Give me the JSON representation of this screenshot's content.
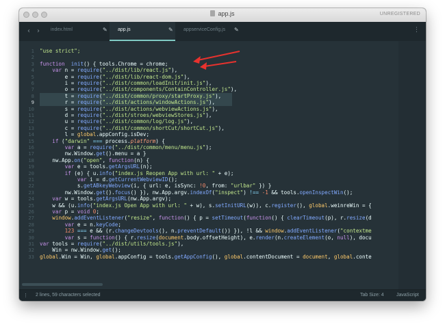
{
  "window": {
    "title": "app.js",
    "registration": "UNREGISTERED"
  },
  "nav": {
    "back": "‹",
    "forward": "›"
  },
  "tabs": [
    {
      "label": "index.html",
      "active": false
    },
    {
      "label": "app.js",
      "active": true
    },
    {
      "label": "appserviceConfig.js",
      "active": false
    }
  ],
  "editor": {
    "current_line": 9,
    "lines": [
      {
        "n": 1,
        "t": [
          [
            "str",
            "\"use strict\";"
          ]
        ]
      },
      {
        "n": 2,
        "t": []
      },
      {
        "n": 3,
        "t": [
          [
            "kw",
            "function"
          ],
          [
            "",
            "  "
          ],
          [
            "fn",
            "init"
          ],
          [
            "",
            "() { tools.Chrome = chrome;"
          ]
        ]
      },
      {
        "n": 4,
        "t": [
          [
            "",
            "    "
          ],
          [
            "kw",
            "var"
          ],
          [
            "",
            " n = "
          ],
          [
            "fn",
            "require"
          ],
          [
            "",
            "("
          ],
          [
            "str",
            "\"../dist/lib/react.js\""
          ],
          [
            "",
            "),"
          ]
        ]
      },
      {
        "n": 5,
        "t": [
          [
            "",
            "        e = "
          ],
          [
            "fn",
            "require"
          ],
          [
            "",
            "("
          ],
          [
            "str",
            "\"../dist/lib/react-dom.js\""
          ],
          [
            "",
            "),"
          ]
        ]
      },
      {
        "n": 6,
        "t": [
          [
            "",
            "        i = "
          ],
          [
            "fn",
            "require"
          ],
          [
            "",
            "("
          ],
          [
            "str",
            "\"../dist/common/loadInit/init.js\""
          ],
          [
            "",
            "),"
          ]
        ]
      },
      {
        "n": 7,
        "t": [
          [
            "",
            "        o = "
          ],
          [
            "fn",
            "require"
          ],
          [
            "",
            "("
          ],
          [
            "str",
            "\"../dist/components/ContainController.js\""
          ],
          [
            "",
            "),"
          ]
        ]
      },
      {
        "n": 8,
        "t": [
          [
            "",
            "        t = "
          ],
          [
            "fn",
            "require"
          ],
          [
            "",
            "("
          ],
          [
            "str",
            "\"../dist/common/proxy/startProxy.js\""
          ],
          [
            "",
            "),"
          ]
        ]
      },
      {
        "n": 9,
        "t": [
          [
            "",
            "        r = "
          ],
          [
            "fn",
            "require"
          ],
          [
            "",
            "("
          ],
          [
            "str",
            "\"../dist/actions/windowActions.js\""
          ],
          [
            "",
            "),"
          ]
        ]
      },
      {
        "n": 10,
        "t": [
          [
            "",
            "        s = "
          ],
          [
            "fn",
            "require"
          ],
          [
            "",
            "("
          ],
          [
            "str",
            "\"../dist/actions/webviewActions.js\""
          ],
          [
            "",
            "),"
          ]
        ]
      },
      {
        "n": 11,
        "t": [
          [
            "",
            "        d = "
          ],
          [
            "fn",
            "require"
          ],
          [
            "",
            "("
          ],
          [
            "str",
            "\"../dist/stroes/webviewStores.js\""
          ],
          [
            "",
            "),"
          ]
        ]
      },
      {
        "n": 12,
        "t": [
          [
            "",
            "        u = "
          ],
          [
            "fn",
            "require"
          ],
          [
            "",
            "("
          ],
          [
            "str",
            "\"../dist/common/log/log.js\""
          ],
          [
            "",
            "),"
          ]
        ]
      },
      {
        "n": 13,
        "t": [
          [
            "",
            "        c = "
          ],
          [
            "fn",
            "require"
          ],
          [
            "",
            "("
          ],
          [
            "str",
            "\"../dist/common/shortCut/shortCut.js\""
          ],
          [
            "",
            "),"
          ]
        ]
      },
      {
        "n": 14,
        "t": [
          [
            "",
            "        l = "
          ],
          [
            "g",
            "global"
          ],
          [
            "",
            ".appConfig.isDev;"
          ]
        ]
      },
      {
        "n": 15,
        "t": [
          [
            "",
            "    "
          ],
          [
            "kw",
            "if"
          ],
          [
            "",
            " ("
          ],
          [
            "str",
            "\"darwin\""
          ],
          [
            "",
            " "
          ],
          [
            "pl",
            "==="
          ],
          [
            "",
            " process."
          ],
          [
            "pr",
            "platform"
          ],
          [
            "",
            ") {"
          ]
        ]
      },
      {
        "n": 16,
        "t": [
          [
            "",
            "        "
          ],
          [
            "kw",
            "var"
          ],
          [
            "",
            " a = "
          ],
          [
            "fn",
            "require"
          ],
          [
            "",
            "("
          ],
          [
            "str",
            "\"../dist/common/menu/menu.js\""
          ],
          [
            "",
            ");"
          ]
        ]
      },
      {
        "n": 17,
        "t": [
          [
            "",
            "        nw.Window."
          ],
          [
            "fn",
            "get"
          ],
          [
            "",
            "().menu = a }"
          ]
        ]
      },
      {
        "n": 18,
        "t": [
          [
            "",
            "    nw.App."
          ],
          [
            "fn",
            "on"
          ],
          [
            "",
            "("
          ],
          [
            "str",
            "\"open\""
          ],
          [
            "",
            ", "
          ],
          [
            "kw",
            "function"
          ],
          [
            "",
            "(n) {"
          ]
        ]
      },
      {
        "n": 19,
        "t": [
          [
            "",
            "        "
          ],
          [
            "kw",
            "var"
          ],
          [
            "",
            " e = tools."
          ],
          [
            "fn",
            "getArgsURL"
          ],
          [
            "",
            "(n);"
          ]
        ]
      },
      {
        "n": 20,
        "t": [
          [
            "",
            "        "
          ],
          [
            "kw",
            "if"
          ],
          [
            "",
            " (e) { u."
          ],
          [
            "fn",
            "info"
          ],
          [
            "",
            "("
          ],
          [
            "str",
            "\"index.js Reopen App with url: \""
          ],
          [
            "",
            " + e);"
          ]
        ]
      },
      {
        "n": 21,
        "t": [
          [
            "",
            "            "
          ],
          [
            "kw",
            "var"
          ],
          [
            "",
            " i = d."
          ],
          [
            "fn",
            "getCurrentWebviewID"
          ],
          [
            "",
            "();"
          ]
        ]
      },
      {
        "n": 22,
        "t": [
          [
            "",
            "            s."
          ],
          [
            "fn",
            "getABkeyWebview"
          ],
          [
            "",
            "(i, { url: e, isSync: "
          ],
          [
            "num",
            "!0"
          ],
          [
            "",
            ", from: "
          ],
          [
            "str",
            "\"urlbar\""
          ],
          [
            "",
            " }) }"
          ]
        ]
      },
      {
        "n": 23,
        "t": [
          [
            "",
            "        nw.Window."
          ],
          [
            "fn",
            "get"
          ],
          [
            "",
            "()."
          ],
          [
            "fn",
            "focus"
          ],
          [
            "",
            "() }), nw.App.argv."
          ],
          [
            "fn",
            "indexOf"
          ],
          [
            "",
            "("
          ],
          [
            "str",
            "\"inspect\""
          ],
          [
            "",
            ") "
          ],
          [
            "pl",
            "!=="
          ],
          [
            "",
            " "
          ],
          [
            "num",
            "-1"
          ],
          [
            "",
            " && tools."
          ],
          [
            "fn",
            "openInspectWin"
          ],
          [
            "",
            "();"
          ]
        ]
      },
      {
        "n": 24,
        "t": [
          [
            "",
            "    "
          ],
          [
            "kw",
            "var"
          ],
          [
            "",
            " w = tools."
          ],
          [
            "fn",
            "getArgsURL"
          ],
          [
            "",
            "(nw.App.argv);"
          ]
        ]
      },
      {
        "n": 25,
        "t": [
          [
            "",
            "    w && (u."
          ],
          [
            "fn",
            "info"
          ],
          [
            "",
            "("
          ],
          [
            "str",
            "\"index.js Open App with url: \""
          ],
          [
            "",
            " + w), s."
          ],
          [
            "fn",
            "setInitURL"
          ],
          [
            "",
            "(w)), c."
          ],
          [
            "fn",
            "register"
          ],
          [
            "",
            "(), "
          ],
          [
            "g",
            "global"
          ],
          [
            "",
            ".weinreWin = {"
          ]
        ]
      },
      {
        "n": 26,
        "t": [
          [
            "",
            "    "
          ],
          [
            "kw",
            "var"
          ],
          [
            "",
            " p = "
          ],
          [
            "kw",
            "void"
          ],
          [
            "",
            " "
          ],
          [
            "num",
            "0"
          ],
          [
            "",
            ";"
          ]
        ]
      },
      {
        "n": 27,
        "t": [
          [
            "",
            "    "
          ],
          [
            "g",
            "window"
          ],
          [
            "",
            "."
          ],
          [
            "fn",
            "addEventListener"
          ],
          [
            "",
            "("
          ],
          [
            "str",
            "\"resize\""
          ],
          [
            "",
            ", "
          ],
          [
            "kw",
            "function"
          ],
          [
            "",
            "() { p = "
          ],
          [
            "fn",
            "setTimeout"
          ],
          [
            "",
            "("
          ],
          [
            "kw",
            "function"
          ],
          [
            "",
            "() { "
          ],
          [
            "fn",
            "clearTimeout"
          ],
          [
            "",
            "(p), r."
          ],
          [
            "fn",
            "resize"
          ],
          [
            "",
            "(d"
          ]
        ]
      },
      {
        "n": 28,
        "t": [
          [
            "",
            "        "
          ],
          [
            "kw",
            "var"
          ],
          [
            "",
            " e = n."
          ],
          [
            "fn",
            "keyCode"
          ],
          [
            "",
            ";"
          ]
        ]
      },
      {
        "n": 29,
        "t": [
          [
            "",
            "        "
          ],
          [
            "num",
            "123"
          ],
          [
            "",
            " "
          ],
          [
            "pl",
            "==="
          ],
          [
            "",
            " e && (r."
          ],
          [
            "fn",
            "changeDevtools"
          ],
          [
            "",
            "(), n."
          ],
          [
            "fn",
            "preventDefault"
          ],
          [
            "",
            "()) }), !l && "
          ],
          [
            "g",
            "window"
          ],
          [
            "",
            "."
          ],
          [
            "fn",
            "addEventListener"
          ],
          [
            "",
            "("
          ],
          [
            "str",
            "\"contextme"
          ]
        ]
      },
      {
        "n": 30,
        "t": [
          [
            "",
            "        "
          ],
          [
            "kw",
            "var"
          ],
          [
            "",
            " s = "
          ],
          [
            "kw",
            "function"
          ],
          [
            "",
            "() { r."
          ],
          [
            "fn",
            "resize"
          ],
          [
            "",
            "("
          ],
          [
            "g",
            "document"
          ],
          [
            "",
            ".body.offsetHeight), e."
          ],
          [
            "fn",
            "render"
          ],
          [
            "",
            "(n."
          ],
          [
            "fn",
            "createElement"
          ],
          [
            "",
            "(o, "
          ],
          [
            "kw",
            "null"
          ],
          [
            "",
            "), docu"
          ]
        ]
      },
      {
        "n": 31,
        "t": [
          [
            "kw",
            "var"
          ],
          [
            "",
            " tools = "
          ],
          [
            "fn",
            "require"
          ],
          [
            "",
            "("
          ],
          [
            "str",
            "\"../dist/utils/tools.js\""
          ],
          [
            "",
            "),"
          ]
        ]
      },
      {
        "n": 32,
        "t": [
          [
            "",
            "    Win = nw.Window."
          ],
          [
            "fn",
            "get"
          ],
          [
            "",
            "();"
          ]
        ]
      },
      {
        "n": 33,
        "t": [
          [
            "g",
            "global"
          ],
          [
            "",
            ".Win = Win, "
          ],
          [
            "g",
            "global"
          ],
          [
            "",
            ".appConfig = tools."
          ],
          [
            "fn",
            "getAppConfig"
          ],
          [
            "",
            "(), "
          ],
          [
            "g",
            "global"
          ],
          [
            "",
            ".contentDocument = "
          ],
          [
            "g",
            "document"
          ],
          [
            "",
            ", "
          ],
          [
            "g",
            "global"
          ],
          [
            "",
            ".conte"
          ]
        ]
      }
    ]
  },
  "statusbar": {
    "selection": "2 lines, 59 characters selected",
    "tab_size": "Tab Size: 4",
    "syntax": "JavaScript"
  },
  "annotations": {
    "arrow_color": "#e8322e"
  }
}
